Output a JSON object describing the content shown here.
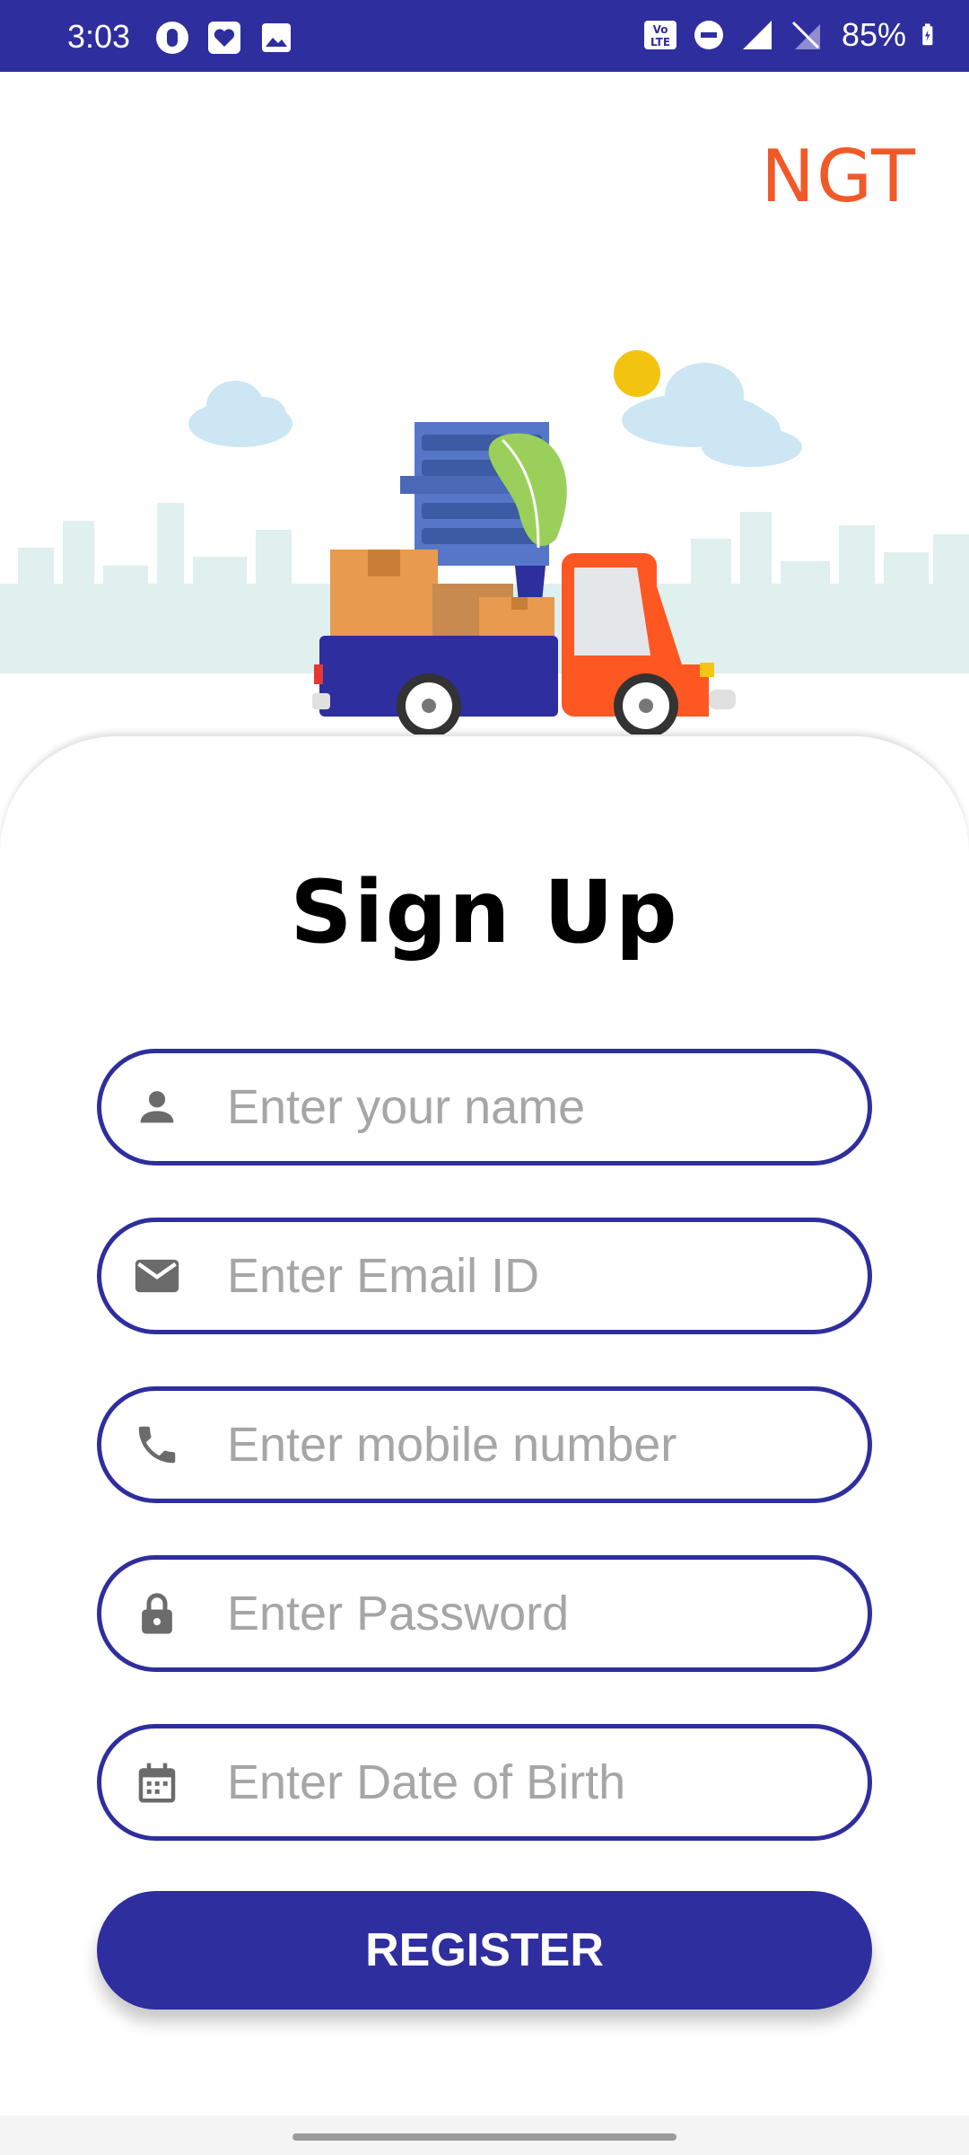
{
  "status_bar": {
    "time": "3:03",
    "battery": "85%",
    "network": "VoLTE"
  },
  "brand": {
    "logo_text": "NGT",
    "color": "#f05a28"
  },
  "hero": {
    "illustration": "delivery-truck-city"
  },
  "form": {
    "title": "Sign Up",
    "fields": [
      {
        "icon": "person-icon",
        "placeholder": "Enter your name",
        "value": ""
      },
      {
        "icon": "mail-icon",
        "placeholder": "Enter Email ID",
        "value": ""
      },
      {
        "icon": "phone-icon",
        "placeholder": "Enter mobile number",
        "value": ""
      },
      {
        "icon": "lock-icon",
        "placeholder": "Enter Password",
        "value": ""
      },
      {
        "icon": "calendar-icon",
        "placeholder": "Enter Date of Birth",
        "value": ""
      }
    ],
    "submit_label": "REGISTER"
  },
  "colors": {
    "primary": "#2e2e9f",
    "accent": "#f05a28",
    "placeholder": "#a6a6a6"
  }
}
